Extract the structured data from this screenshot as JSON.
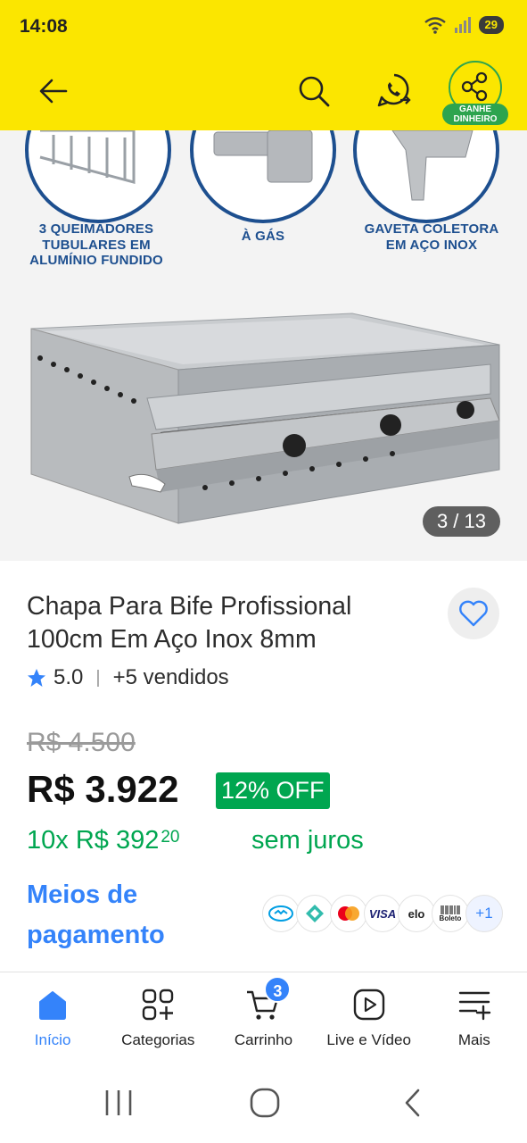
{
  "status_bar": {
    "time": "14:08",
    "battery": "29",
    "wifi_sup": "6"
  },
  "header": {
    "share_badge": "GANHE\nDINHEIRO"
  },
  "gallery": {
    "features": [
      "3 QUEIMADORES\nTUBULARES EM\nALUMÍNIO FUNDIDO",
      "À GÁS",
      "GAVETA COLETORA\nEM AÇO INOX"
    ],
    "counter": "3 / 13"
  },
  "product": {
    "title": "Chapa Para Bife Profissional 100cm Em Aço Inox 8mm",
    "rating": "5.0",
    "sold": "+5 vendidos",
    "old_price": "R$ 4.500",
    "price": "R$ 3.922",
    "discount": "12% OFF",
    "installments": "10x R$ 392",
    "installments_cents": "20",
    "interest": "sem juros",
    "payment_link": "Meios de\npagamento",
    "payment_methods": [
      "mercado-pago",
      "pix",
      "mastercard",
      "VISA",
      "elo",
      "Boleto"
    ],
    "payment_more": "+1"
  },
  "bottom_nav": {
    "items": [
      {
        "label": "Início",
        "icon": "home-icon",
        "active": true
      },
      {
        "label": "Categorias",
        "icon": "categories-icon"
      },
      {
        "label": "Carrinho",
        "icon": "cart-icon",
        "badge": "3"
      },
      {
        "label": "Live e Vídeo",
        "icon": "play-icon"
      },
      {
        "label": "Mais",
        "icon": "menu-plus-icon"
      }
    ]
  },
  "colors": {
    "brand_yellow": "#fbe600",
    "link_blue": "#3483fa",
    "green": "#00a650"
  }
}
